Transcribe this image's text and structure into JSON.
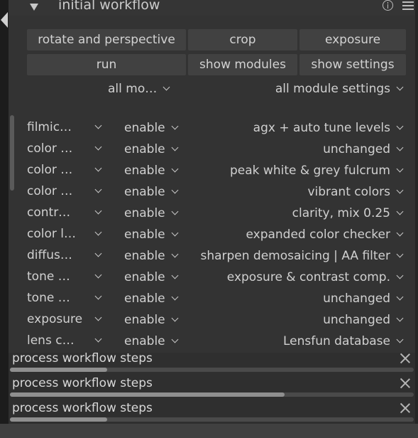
{
  "module": {
    "title": "initial workflow",
    "info_icon": "info-icon",
    "menu_icon": "hamburger-menu-icon"
  },
  "buttons": {
    "rotate": "rotate and perspective",
    "crop": "crop",
    "exposure": "exposure",
    "run": "run",
    "show_modules": "show modules",
    "show_settings": "show settings"
  },
  "filters": {
    "modules": "all mo…",
    "settings": "all module settings"
  },
  "rows": [
    {
      "module": "filmic…",
      "state": "enable",
      "preset": "agx + auto tune levels"
    },
    {
      "module": "color …",
      "state": "enable",
      "preset": "unchanged"
    },
    {
      "module": "color …",
      "state": "enable",
      "preset": "peak white & grey fulcrum"
    },
    {
      "module": "color …",
      "state": "enable",
      "preset": "vibrant colors"
    },
    {
      "module": "contr…",
      "state": "enable",
      "preset": "clarity, mix 0.25"
    },
    {
      "module": "color l…",
      "state": "enable",
      "preset": "expanded color checker"
    },
    {
      "module": "diffus…",
      "state": "enable",
      "preset": "sharpen demosaicing | AA filter"
    },
    {
      "module": "tone …",
      "state": "enable",
      "preset": "exposure & contrast comp."
    },
    {
      "module": "tone …",
      "state": "enable",
      "preset": "unchanged"
    },
    {
      "module": "exposure",
      "state": "enable",
      "preset": "unchanged"
    },
    {
      "module": "lens c…",
      "state": "enable",
      "preset": "Lensfun database"
    }
  ],
  "progress": [
    {
      "label": "process workflow steps",
      "fraction": 0.24
    },
    {
      "label": "process workflow steps",
      "fraction": 0.68
    },
    {
      "label": "process workflow steps",
      "fraction": 0.24
    }
  ],
  "colors": {
    "panel_bg": "#333333",
    "button_bg": "#414141",
    "text": "#d0d0d0",
    "progress_fill": "#8f8f8f"
  }
}
